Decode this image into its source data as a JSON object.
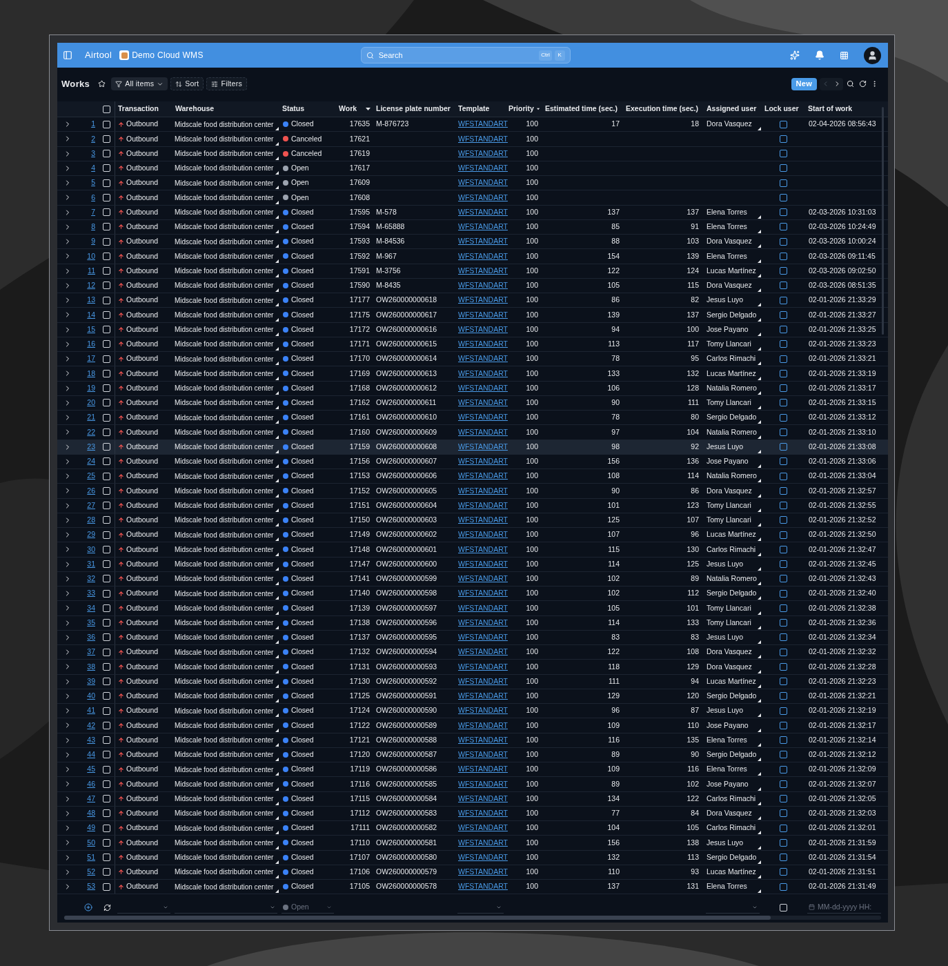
{
  "app_bar": {
    "brand": "Airtool",
    "workspace": "Demo Cloud WMS",
    "search": {
      "placeholder": "Search",
      "shortcut": [
        "Ctrl",
        "K"
      ]
    }
  },
  "toolbar": {
    "title": "Works",
    "favorite": false,
    "view": "All items",
    "buttons": [
      "Sort",
      "Filters"
    ],
    "new_button": "New",
    "pager": [
      {
        "kind": "prev",
        "disabled": true
      },
      {
        "kind": "next",
        "disabled": false
      }
    ]
  },
  "table": {
    "select_all": false,
    "columns": [
      {
        "label": "Transaction",
        "sorted": false
      },
      {
        "label": "Warehouse",
        "sorted": false
      },
      {
        "label": "Status",
        "sorted": false
      },
      {
        "label": "Work",
        "sorted": true
      },
      {
        "label": "License plate number",
        "sorted": false
      },
      {
        "label": "Template",
        "sorted": false
      },
      {
        "label": "Priority",
        "sorted": true
      },
      {
        "label": "Estimated time (sec.)",
        "sorted": false
      },
      {
        "label": "Execution time (sec.)",
        "sorted": false
      },
      {
        "label": "Assigned user",
        "sorted": false
      },
      {
        "label": "Lock user",
        "sorted": false
      },
      {
        "label": "Start of work",
        "sorted": false
      }
    ],
    "rows": [
      {
        "n": "1",
        "checked": false,
        "selected": false,
        "transaction": "Outbound",
        "warehouse": "Midscale food distribution center",
        "status": "Closed",
        "color": "#3b82f6",
        "work": "17635",
        "plate": "M-876723",
        "template": "WFSTANDART",
        "priority": "100",
        "est": "17",
        "exec": "18",
        "user": "Dora Vasquez",
        "locked": false,
        "start": "02-04-2026 08:56:43"
      },
      {
        "n": "2",
        "checked": false,
        "selected": false,
        "transaction": "Outbound",
        "warehouse": "Midscale food distribution center",
        "status": "Canceled",
        "color": "#ef5350",
        "work": "17621",
        "template": "WFSTANDART",
        "priority": "100",
        "locked": false
      },
      {
        "n": "3",
        "checked": false,
        "selected": false,
        "transaction": "Outbound",
        "warehouse": "Midscale food distribution center",
        "status": "Canceled",
        "color": "#ef5350",
        "work": "17619",
        "template": "WFSTANDART",
        "priority": "100",
        "locked": false
      },
      {
        "n": "4",
        "checked": false,
        "selected": false,
        "transaction": "Outbound",
        "warehouse": "Midscale food distribution center",
        "status": "Open",
        "color": "#9ca3af",
        "work": "17617",
        "template": "WFSTANDART",
        "priority": "100",
        "locked": false
      },
      {
        "n": "5",
        "checked": false,
        "selected": false,
        "transaction": "Outbound",
        "warehouse": "Midscale food distribution center",
        "status": "Open",
        "color": "#9ca3af",
        "work": "17609",
        "template": "WFSTANDART",
        "priority": "100",
        "locked": false
      },
      {
        "n": "6",
        "checked": false,
        "selected": false,
        "transaction": "Outbound",
        "warehouse": "Midscale food distribution center",
        "status": "Open",
        "color": "#9ca3af",
        "work": "17608",
        "template": "WFSTANDART",
        "priority": "100",
        "locked": false
      },
      {
        "n": "7",
        "checked": false,
        "selected": false,
        "transaction": "Outbound",
        "warehouse": "Midscale food distribution center",
        "status": "Closed",
        "color": "#3b82f6",
        "work": "17595",
        "plate": "M-578",
        "template": "WFSTANDART",
        "priority": "100",
        "est": "137",
        "exec": "137",
        "user": "Elena Torres",
        "locked": false,
        "start": "02-03-2026 10:31:03"
      },
      {
        "n": "8",
        "checked": false,
        "selected": false,
        "transaction": "Outbound",
        "warehouse": "Midscale food distribution center",
        "status": "Closed",
        "color": "#3b82f6",
        "work": "17594",
        "plate": "M-65888",
        "template": "WFSTANDART",
        "priority": "100",
        "est": "85",
        "exec": "91",
        "user": "Elena Torres",
        "locked": false,
        "start": "02-03-2026 10:24:49"
      },
      {
        "n": "9",
        "checked": false,
        "selected": false,
        "transaction": "Outbound",
        "warehouse": "Midscale food distribution center",
        "status": "Closed",
        "color": "#3b82f6",
        "work": "17593",
        "plate": "M-84536",
        "template": "WFSTANDART",
        "priority": "100",
        "est": "88",
        "exec": "103",
        "user": "Dora Vasquez",
        "locked": false,
        "start": "02-03-2026 10:00:24"
      },
      {
        "n": "10",
        "checked": false,
        "selected": false,
        "transaction": "Outbound",
        "warehouse": "Midscale food distribution center",
        "status": "Closed",
        "color": "#3b82f6",
        "work": "17592",
        "plate": "M-967",
        "template": "WFSTANDART",
        "priority": "100",
        "est": "154",
        "exec": "139",
        "user": "Elena Torres",
        "locked": false,
        "start": "02-03-2026 09:11:45"
      },
      {
        "n": "11",
        "checked": false,
        "selected": false,
        "transaction": "Outbound",
        "warehouse": "Midscale food distribution center",
        "status": "Closed",
        "color": "#3b82f6",
        "work": "17591",
        "plate": "M-3756",
        "template": "WFSTANDART",
        "priority": "100",
        "est": "122",
        "exec": "124",
        "user": "Lucas Martínez",
        "locked": false,
        "start": "02-03-2026 09:02:50"
      },
      {
        "n": "12",
        "checked": false,
        "selected": false,
        "transaction": "Outbound",
        "warehouse": "Midscale food distribution center",
        "status": "Closed",
        "color": "#3b82f6",
        "work": "17590",
        "plate": "M-8435",
        "template": "WFSTANDART",
        "priority": "100",
        "est": "105",
        "exec": "115",
        "user": "Dora Vasquez",
        "locked": false,
        "start": "02-03-2026 08:51:35"
      },
      {
        "n": "13",
        "checked": false,
        "selected": false,
        "transaction": "Outbound",
        "warehouse": "Midscale food distribution center",
        "status": "Closed",
        "color": "#3b82f6",
        "work": "17177",
        "plate": "OW260000000618",
        "template": "WFSTANDART",
        "priority": "100",
        "est": "86",
        "exec": "82",
        "user": "Jesus Luyo",
        "locked": false,
        "start": "02-01-2026 21:33:29"
      },
      {
        "n": "14",
        "checked": false,
        "selected": false,
        "transaction": "Outbound",
        "warehouse": "Midscale food distribution center",
        "status": "Closed",
        "color": "#3b82f6",
        "work": "17175",
        "plate": "OW260000000617",
        "template": "WFSTANDART",
        "priority": "100",
        "est": "139",
        "exec": "137",
        "user": "Sergio Delgado",
        "locked": false,
        "start": "02-01-2026 21:33:27"
      },
      {
        "n": "15",
        "checked": false,
        "selected": false,
        "transaction": "Outbound",
        "warehouse": "Midscale food distribution center",
        "status": "Closed",
        "color": "#3b82f6",
        "work": "17172",
        "plate": "OW260000000616",
        "template": "WFSTANDART",
        "priority": "100",
        "est": "94",
        "exec": "100",
        "user": "Jose Payano",
        "locked": false,
        "start": "02-01-2026 21:33:25"
      },
      {
        "n": "16",
        "checked": false,
        "selected": false,
        "transaction": "Outbound",
        "warehouse": "Midscale food distribution center",
        "status": "Closed",
        "color": "#3b82f6",
        "work": "17171",
        "plate": "OW260000000615",
        "template": "WFSTANDART",
        "priority": "100",
        "est": "113",
        "exec": "117",
        "user": "Tomy Llancari",
        "locked": false,
        "start": "02-01-2026 21:33:23"
      },
      {
        "n": "17",
        "checked": false,
        "selected": false,
        "transaction": "Outbound",
        "warehouse": "Midscale food distribution center",
        "status": "Closed",
        "color": "#3b82f6",
        "work": "17170",
        "plate": "OW260000000614",
        "template": "WFSTANDART",
        "priority": "100",
        "est": "78",
        "exec": "95",
        "user": "Carlos Rimachi",
        "locked": false,
        "start": "02-01-2026 21:33:21"
      },
      {
        "n": "18",
        "checked": false,
        "selected": false,
        "transaction": "Outbound",
        "warehouse": "Midscale food distribution center",
        "status": "Closed",
        "color": "#3b82f6",
        "work": "17169",
        "plate": "OW260000000613",
        "template": "WFSTANDART",
        "priority": "100",
        "est": "133",
        "exec": "132",
        "user": "Lucas Martínez",
        "locked": false,
        "start": "02-01-2026 21:33:19"
      },
      {
        "n": "19",
        "checked": false,
        "selected": false,
        "transaction": "Outbound",
        "warehouse": "Midscale food distribution center",
        "status": "Closed",
        "color": "#3b82f6",
        "work": "17168",
        "plate": "OW260000000612",
        "template": "WFSTANDART",
        "priority": "100",
        "est": "106",
        "exec": "128",
        "user": "Natalia Romero",
        "locked": false,
        "start": "02-01-2026 21:33:17"
      },
      {
        "n": "20",
        "checked": false,
        "selected": false,
        "transaction": "Outbound",
        "warehouse": "Midscale food distribution center",
        "status": "Closed",
        "color": "#3b82f6",
        "work": "17162",
        "plate": "OW260000000611",
        "template": "WFSTANDART",
        "priority": "100",
        "est": "90",
        "exec": "111",
        "user": "Tomy Llancari",
        "locked": false,
        "start": "02-01-2026 21:33:15"
      },
      {
        "n": "21",
        "checked": false,
        "selected": false,
        "transaction": "Outbound",
        "warehouse": "Midscale food distribution center",
        "status": "Closed",
        "color": "#3b82f6",
        "work": "17161",
        "plate": "OW260000000610",
        "template": "WFSTANDART",
        "priority": "100",
        "est": "78",
        "exec": "80",
        "user": "Sergio Delgado",
        "locked": false,
        "start": "02-01-2026 21:33:12"
      },
      {
        "n": "22",
        "checked": false,
        "selected": false,
        "transaction": "Outbound",
        "warehouse": "Midscale food distribution center",
        "status": "Closed",
        "color": "#3b82f6",
        "work": "17160",
        "plate": "OW260000000609",
        "template": "WFSTANDART",
        "priority": "100",
        "est": "97",
        "exec": "104",
        "user": "Natalia Romero",
        "locked": false,
        "start": "02-01-2026 21:33:10"
      },
      {
        "n": "23",
        "checked": false,
        "selected": true,
        "transaction": "Outbound",
        "warehouse": "Midscale food distribution center",
        "status": "Closed",
        "color": "#3b82f6",
        "work": "17159",
        "plate": "OW260000000608",
        "template": "WFSTANDART",
        "priority": "100",
        "est": "98",
        "exec": "92",
        "user": "Jesus Luyo",
        "locked": false,
        "start": "02-01-2026 21:33:08"
      },
      {
        "n": "24",
        "checked": false,
        "selected": false,
        "transaction": "Outbound",
        "warehouse": "Midscale food distribution center",
        "status": "Closed",
        "color": "#3b82f6",
        "work": "17156",
        "plate": "OW260000000607",
        "template": "WFSTANDART",
        "priority": "100",
        "est": "156",
        "exec": "136",
        "user": "Jose Payano",
        "locked": false,
        "start": "02-01-2026 21:33:06"
      },
      {
        "n": "25",
        "checked": false,
        "selected": false,
        "transaction": "Outbound",
        "warehouse": "Midscale food distribution center",
        "status": "Closed",
        "color": "#3b82f6",
        "work": "17153",
        "plate": "OW260000000606",
        "template": "WFSTANDART",
        "priority": "100",
        "est": "108",
        "exec": "114",
        "user": "Natalia Romero",
        "locked": false,
        "start": "02-01-2026 21:33:04"
      },
      {
        "n": "26",
        "checked": false,
        "selected": false,
        "transaction": "Outbound",
        "warehouse": "Midscale food distribution center",
        "status": "Closed",
        "color": "#3b82f6",
        "work": "17152",
        "plate": "OW260000000605",
        "template": "WFSTANDART",
        "priority": "100",
        "est": "90",
        "exec": "86",
        "user": "Dora Vasquez",
        "locked": false,
        "start": "02-01-2026 21:32:57"
      },
      {
        "n": "27",
        "checked": false,
        "selected": false,
        "transaction": "Outbound",
        "warehouse": "Midscale food distribution center",
        "status": "Closed",
        "color": "#3b82f6",
        "work": "17151",
        "plate": "OW260000000604",
        "template": "WFSTANDART",
        "priority": "100",
        "est": "101",
        "exec": "123",
        "user": "Tomy Llancari",
        "locked": false,
        "start": "02-01-2026 21:32:55"
      },
      {
        "n": "28",
        "checked": false,
        "selected": false,
        "transaction": "Outbound",
        "warehouse": "Midscale food distribution center",
        "status": "Closed",
        "color": "#3b82f6",
        "work": "17150",
        "plate": "OW260000000603",
        "template": "WFSTANDART",
        "priority": "100",
        "est": "125",
        "exec": "107",
        "user": "Tomy Llancari",
        "locked": false,
        "start": "02-01-2026 21:32:52"
      },
      {
        "n": "29",
        "checked": false,
        "selected": false,
        "transaction": "Outbound",
        "warehouse": "Midscale food distribution center",
        "status": "Closed",
        "color": "#3b82f6",
        "work": "17149",
        "plate": "OW260000000602",
        "template": "WFSTANDART",
        "priority": "100",
        "est": "107",
        "exec": "96",
        "user": "Lucas Martínez",
        "locked": false,
        "start": "02-01-2026 21:32:50"
      },
      {
        "n": "30",
        "checked": false,
        "selected": false,
        "transaction": "Outbound",
        "warehouse": "Midscale food distribution center",
        "status": "Closed",
        "color": "#3b82f6",
        "work": "17148",
        "plate": "OW260000000601",
        "template": "WFSTANDART",
        "priority": "100",
        "est": "115",
        "exec": "130",
        "user": "Carlos Rimachi",
        "locked": false,
        "start": "02-01-2026 21:32:47"
      },
      {
        "n": "31",
        "checked": false,
        "selected": false,
        "transaction": "Outbound",
        "warehouse": "Midscale food distribution center",
        "status": "Closed",
        "color": "#3b82f6",
        "work": "17147",
        "plate": "OW260000000600",
        "template": "WFSTANDART",
        "priority": "100",
        "est": "114",
        "exec": "125",
        "user": "Jesus Luyo",
        "locked": false,
        "start": "02-01-2026 21:32:45"
      },
      {
        "n": "32",
        "checked": false,
        "selected": false,
        "transaction": "Outbound",
        "warehouse": "Midscale food distribution center",
        "status": "Closed",
        "color": "#3b82f6",
        "work": "17141",
        "plate": "OW260000000599",
        "template": "WFSTANDART",
        "priority": "100",
        "est": "102",
        "exec": "89",
        "user": "Natalia Romero",
        "locked": false,
        "start": "02-01-2026 21:32:43"
      },
      {
        "n": "33",
        "checked": false,
        "selected": false,
        "transaction": "Outbound",
        "warehouse": "Midscale food distribution center",
        "status": "Closed",
        "color": "#3b82f6",
        "work": "17140",
        "plate": "OW260000000598",
        "template": "WFSTANDART",
        "priority": "100",
        "est": "102",
        "exec": "112",
        "user": "Sergio Delgado",
        "locked": false,
        "start": "02-01-2026 21:32:40"
      },
      {
        "n": "34",
        "checked": false,
        "selected": false,
        "transaction": "Outbound",
        "warehouse": "Midscale food distribution center",
        "status": "Closed",
        "color": "#3b82f6",
        "work": "17139",
        "plate": "OW260000000597",
        "template": "WFSTANDART",
        "priority": "100",
        "est": "105",
        "exec": "101",
        "user": "Tomy Llancari",
        "locked": false,
        "start": "02-01-2026 21:32:38"
      },
      {
        "n": "35",
        "checked": false,
        "selected": false,
        "transaction": "Outbound",
        "warehouse": "Midscale food distribution center",
        "status": "Closed",
        "color": "#3b82f6",
        "work": "17138",
        "plate": "OW260000000596",
        "template": "WFSTANDART",
        "priority": "100",
        "est": "114",
        "exec": "133",
        "user": "Tomy Llancari",
        "locked": false,
        "start": "02-01-2026 21:32:36"
      },
      {
        "n": "36",
        "checked": false,
        "selected": false,
        "transaction": "Outbound",
        "warehouse": "Midscale food distribution center",
        "status": "Closed",
        "color": "#3b82f6",
        "work": "17137",
        "plate": "OW260000000595",
        "template": "WFSTANDART",
        "priority": "100",
        "est": "83",
        "exec": "83",
        "user": "Jesus Luyo",
        "locked": false,
        "start": "02-01-2026 21:32:34"
      },
      {
        "n": "37",
        "checked": false,
        "selected": false,
        "transaction": "Outbound",
        "warehouse": "Midscale food distribution center",
        "status": "Closed",
        "color": "#3b82f6",
        "work": "17132",
        "plate": "OW260000000594",
        "template": "WFSTANDART",
        "priority": "100",
        "est": "122",
        "exec": "108",
        "user": "Dora Vasquez",
        "locked": false,
        "start": "02-01-2026 21:32:32"
      },
      {
        "n": "38",
        "checked": false,
        "selected": false,
        "transaction": "Outbound",
        "warehouse": "Midscale food distribution center",
        "status": "Closed",
        "color": "#3b82f6",
        "work": "17131",
        "plate": "OW260000000593",
        "template": "WFSTANDART",
        "priority": "100",
        "est": "118",
        "exec": "129",
        "user": "Dora Vasquez",
        "locked": false,
        "start": "02-01-2026 21:32:28"
      },
      {
        "n": "39",
        "checked": false,
        "selected": false,
        "transaction": "Outbound",
        "warehouse": "Midscale food distribution center",
        "status": "Closed",
        "color": "#3b82f6",
        "work": "17130",
        "plate": "OW260000000592",
        "template": "WFSTANDART",
        "priority": "100",
        "est": "111",
        "exec": "94",
        "user": "Lucas Martínez",
        "locked": false,
        "start": "02-01-2026 21:32:23"
      },
      {
        "n": "40",
        "checked": false,
        "selected": false,
        "transaction": "Outbound",
        "warehouse": "Midscale food distribution center",
        "status": "Closed",
        "color": "#3b82f6",
        "work": "17125",
        "plate": "OW260000000591",
        "template": "WFSTANDART",
        "priority": "100",
        "est": "129",
        "exec": "120",
        "user": "Sergio Delgado",
        "locked": false,
        "start": "02-01-2026 21:32:21"
      },
      {
        "n": "41",
        "checked": false,
        "selected": false,
        "transaction": "Outbound",
        "warehouse": "Midscale food distribution center",
        "status": "Closed",
        "color": "#3b82f6",
        "work": "17124",
        "plate": "OW260000000590",
        "template": "WFSTANDART",
        "priority": "100",
        "est": "96",
        "exec": "87",
        "user": "Jesus Luyo",
        "locked": false,
        "start": "02-01-2026 21:32:19"
      },
      {
        "n": "42",
        "checked": false,
        "selected": false,
        "transaction": "Outbound",
        "warehouse": "Midscale food distribution center",
        "status": "Closed",
        "color": "#3b82f6",
        "work": "17122",
        "plate": "OW260000000589",
        "template": "WFSTANDART",
        "priority": "100",
        "est": "109",
        "exec": "110",
        "user": "Jose Payano",
        "locked": false,
        "start": "02-01-2026 21:32:17"
      },
      {
        "n": "43",
        "checked": false,
        "selected": false,
        "transaction": "Outbound",
        "warehouse": "Midscale food distribution center",
        "status": "Closed",
        "color": "#3b82f6",
        "work": "17121",
        "plate": "OW260000000588",
        "template": "WFSTANDART",
        "priority": "100",
        "est": "116",
        "exec": "135",
        "user": "Elena Torres",
        "locked": false,
        "start": "02-01-2026 21:32:14"
      },
      {
        "n": "44",
        "checked": false,
        "selected": false,
        "transaction": "Outbound",
        "warehouse": "Midscale food distribution center",
        "status": "Closed",
        "color": "#3b82f6",
        "work": "17120",
        "plate": "OW260000000587",
        "template": "WFSTANDART",
        "priority": "100",
        "est": "89",
        "exec": "90",
        "user": "Sergio Delgado",
        "locked": false,
        "start": "02-01-2026 21:32:12"
      },
      {
        "n": "45",
        "checked": false,
        "selected": false,
        "transaction": "Outbound",
        "warehouse": "Midscale food distribution center",
        "status": "Closed",
        "color": "#3b82f6",
        "work": "17119",
        "plate": "OW260000000586",
        "template": "WFSTANDART",
        "priority": "100",
        "est": "109",
        "exec": "116",
        "user": "Elena Torres",
        "locked": false,
        "start": "02-01-2026 21:32:09"
      },
      {
        "n": "46",
        "checked": false,
        "selected": false,
        "transaction": "Outbound",
        "warehouse": "Midscale food distribution center",
        "status": "Closed",
        "color": "#3b82f6",
        "work": "17116",
        "plate": "OW260000000585",
        "template": "WFSTANDART",
        "priority": "100",
        "est": "89",
        "exec": "102",
        "user": "Jose Payano",
        "locked": false,
        "start": "02-01-2026 21:32:07"
      },
      {
        "n": "47",
        "checked": false,
        "selected": false,
        "transaction": "Outbound",
        "warehouse": "Midscale food distribution center",
        "status": "Closed",
        "color": "#3b82f6",
        "work": "17115",
        "plate": "OW260000000584",
        "template": "WFSTANDART",
        "priority": "100",
        "est": "134",
        "exec": "122",
        "user": "Carlos Rimachi",
        "locked": false,
        "start": "02-01-2026 21:32:05"
      },
      {
        "n": "48",
        "checked": false,
        "selected": false,
        "transaction": "Outbound",
        "warehouse": "Midscale food distribution center",
        "status": "Closed",
        "color": "#3b82f6",
        "work": "17112",
        "plate": "OW260000000583",
        "template": "WFSTANDART",
        "priority": "100",
        "est": "77",
        "exec": "84",
        "user": "Dora Vasquez",
        "locked": false,
        "start": "02-01-2026 21:32:03"
      },
      {
        "n": "49",
        "checked": false,
        "selected": false,
        "transaction": "Outbound",
        "warehouse": "Midscale food distribution center",
        "status": "Closed",
        "color": "#3b82f6",
        "work": "17111",
        "plate": "OW260000000582",
        "template": "WFSTANDART",
        "priority": "100",
        "est": "104",
        "exec": "105",
        "user": "Carlos Rimachi",
        "locked": false,
        "start": "02-01-2026 21:32:01"
      },
      {
        "n": "50",
        "checked": false,
        "selected": false,
        "transaction": "Outbound",
        "warehouse": "Midscale food distribution center",
        "status": "Closed",
        "color": "#3b82f6",
        "work": "17110",
        "plate": "OW260000000581",
        "template": "WFSTANDART",
        "priority": "100",
        "est": "156",
        "exec": "138",
        "user": "Jesus Luyo",
        "locked": false,
        "start": "02-01-2026 21:31:59"
      },
      {
        "n": "51",
        "checked": false,
        "selected": false,
        "transaction": "Outbound",
        "warehouse": "Midscale food distribution center",
        "status": "Closed",
        "color": "#3b82f6",
        "work": "17107",
        "plate": "OW260000000580",
        "template": "WFSTANDART",
        "priority": "100",
        "est": "132",
        "exec": "113",
        "user": "Sergio Delgado",
        "locked": false,
        "start": "02-01-2026 21:31:54"
      },
      {
        "n": "52",
        "checked": false,
        "selected": false,
        "transaction": "Outbound",
        "warehouse": "Midscale food distribution center",
        "status": "Closed",
        "color": "#3b82f6",
        "work": "17106",
        "plate": "OW260000000579",
        "template": "WFSTANDART",
        "priority": "100",
        "est": "110",
        "exec": "93",
        "user": "Lucas Martínez",
        "locked": false,
        "start": "02-01-2026 21:31:51"
      },
      {
        "n": "53",
        "checked": false,
        "selected": false,
        "transaction": "Outbound",
        "warehouse": "Midscale food distribution center",
        "status": "Closed",
        "color": "#3b82f6",
        "work": "17105",
        "plate": "OW260000000578",
        "template": "WFSTANDART",
        "priority": "100",
        "est": "137",
        "exec": "131",
        "user": "Elena Torres",
        "locked": false,
        "start": "02-01-2026 21:31:49"
      }
    ],
    "filter_row": {
      "status": {
        "placeholder": "Open",
        "color": "#6b7280"
      },
      "lock_user": {
        "checked": false
      },
      "start_of_work": {
        "placeholder": "MM-dd-yyyy HH:"
      }
    }
  }
}
